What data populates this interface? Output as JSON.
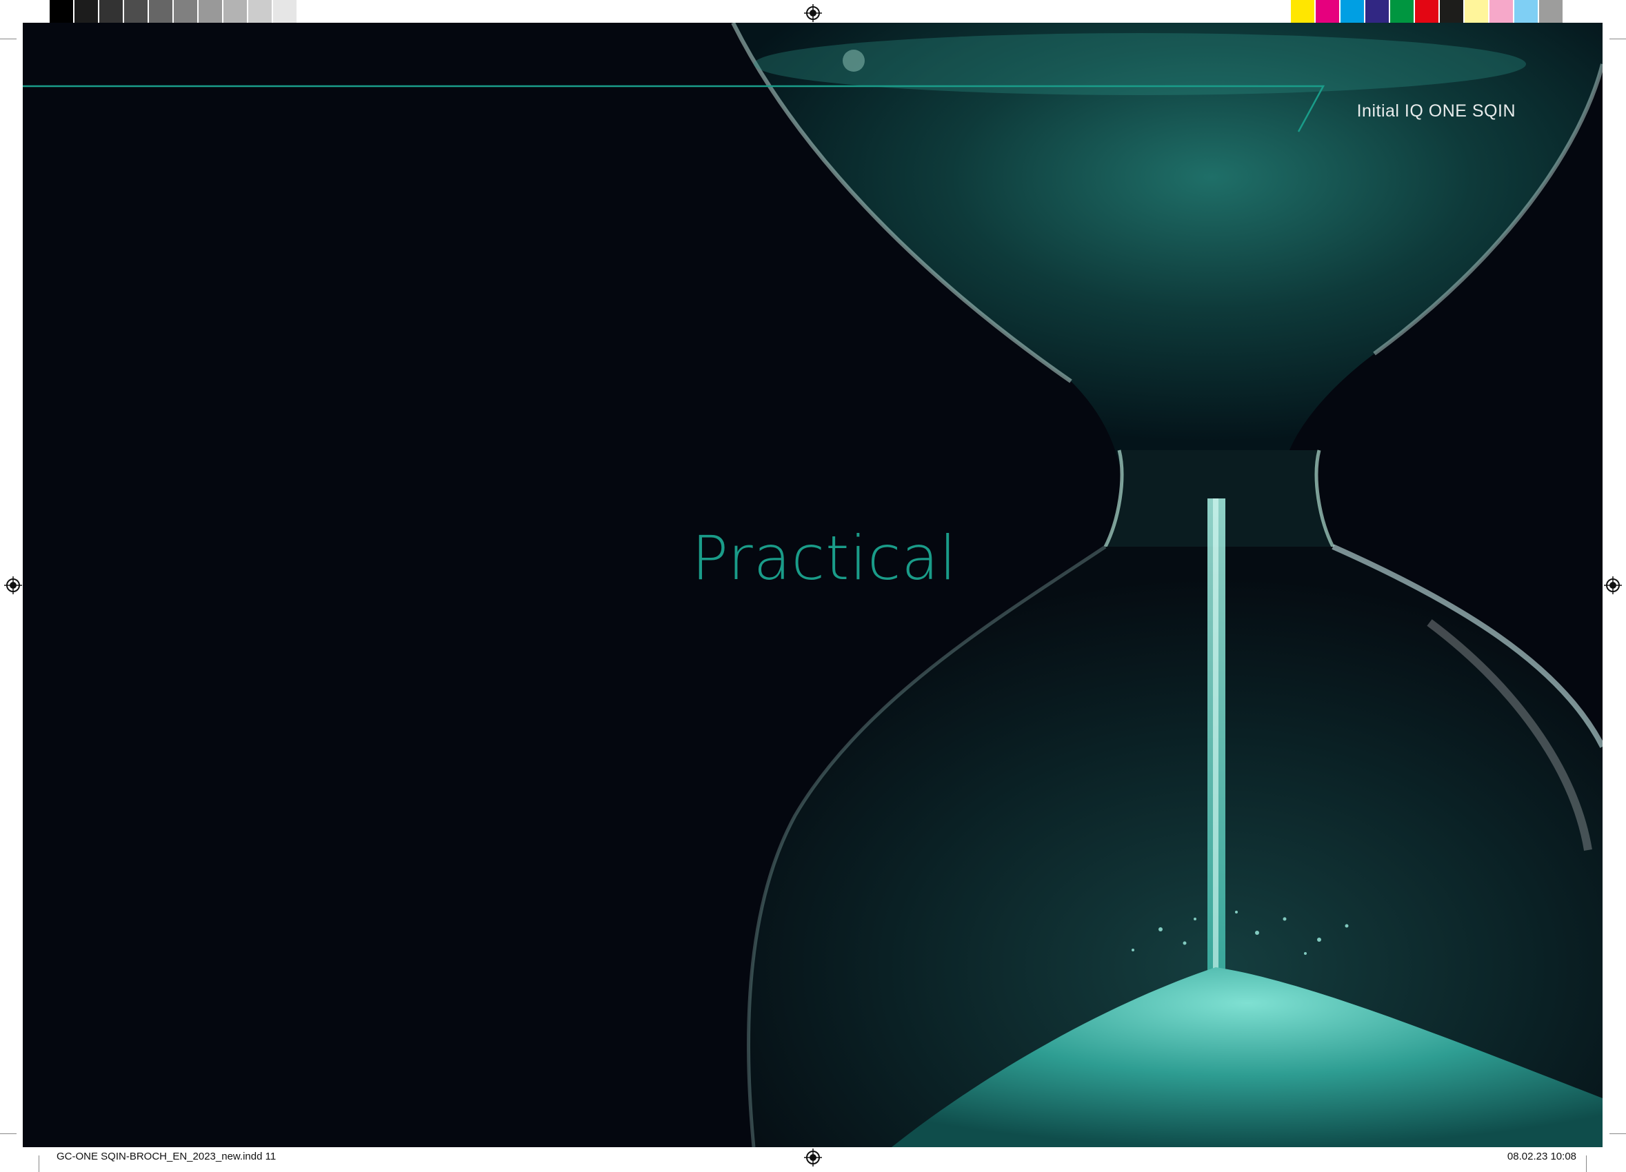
{
  "header": {
    "label": "Initial IQ ONE SQIN"
  },
  "main": {
    "title": "Practical"
  },
  "slug": {
    "file": "GC-ONE SQIN-BROCH_EN_2023_new.indd   11",
    "datetime": "08.02.23   10:08"
  },
  "colors": {
    "background": "#04070f",
    "accent": "#1a9c89",
    "header_text": "#e8ecec",
    "sand": "#3fb9aa"
  },
  "color_bar": {
    "grays": [
      "#000000",
      "#1c1c1c",
      "#333333",
      "#4d4d4d",
      "#666666",
      "#808080",
      "#999999",
      "#b3b3b3",
      "#cccccc",
      "#e6e6e6",
      "#ffffff"
    ],
    "process": [
      "#ffe600",
      "#e6007e",
      "#009fe3",
      "#312783",
      "#009640",
      "#e30613",
      "#1d1d1b",
      "#fff59b",
      "#f6a8c9",
      "#7fcff4",
      "#9d9d9c"
    ]
  }
}
